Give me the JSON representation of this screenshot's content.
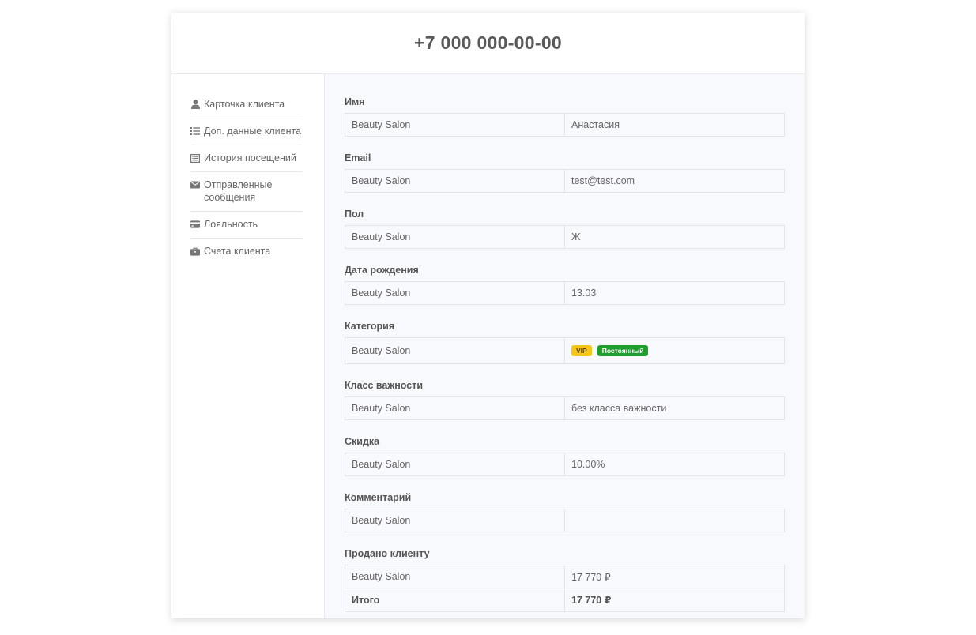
{
  "header": {
    "title": "+7 000 000-00-00"
  },
  "sidebar": {
    "items": [
      {
        "label": "Карточка клиента",
        "icon": "user-icon"
      },
      {
        "label": "Доп. данные клиента",
        "icon": "list-icon"
      },
      {
        "label": "История посещений",
        "icon": "table-list-icon"
      },
      {
        "label": "Отправленные сообщения",
        "icon": "envelope-icon"
      },
      {
        "label": "Лояльность",
        "icon": "credit-card-icon"
      },
      {
        "label": "Счета клиента",
        "icon": "briefcase-icon"
      }
    ]
  },
  "fields": {
    "name": {
      "label": "Имя",
      "source": "Beauty Salon",
      "value": "Анастасия"
    },
    "email": {
      "label": "Email",
      "source": "Beauty Salon",
      "value": "test@test.com"
    },
    "gender": {
      "label": "Пол",
      "source": "Beauty Salon",
      "value": "Ж"
    },
    "birthday": {
      "label": "Дата рождения",
      "source": "Beauty Salon",
      "value": "13.03"
    },
    "category": {
      "label": "Категория",
      "source": "Beauty Salon",
      "badges": [
        {
          "text": "VIP",
          "color": "#f5c518",
          "text_color": "#5a4500"
        },
        {
          "text": "Постоянный",
          "color": "#1f9d2d",
          "text_color": "#ffffff"
        }
      ]
    },
    "importance": {
      "label": "Класс важности",
      "source": "Beauty Salon",
      "value": "без класса важности"
    },
    "discount": {
      "label": "Скидка",
      "source": "Beauty Salon",
      "value": "10.00%"
    },
    "comment": {
      "label": "Комментарий",
      "source": "Beauty Salon",
      "value": ""
    },
    "sold": {
      "label": "Продано клиенту",
      "rows": [
        {
          "source": "Beauty Salon",
          "value": "17 770 ₽"
        },
        {
          "source": "Итого",
          "value": "17 770 ₽"
        }
      ]
    }
  },
  "colors": {
    "sidebar_icon": "#777777",
    "main_bg": "#f8f9fc",
    "border": "#e3e5ea"
  }
}
